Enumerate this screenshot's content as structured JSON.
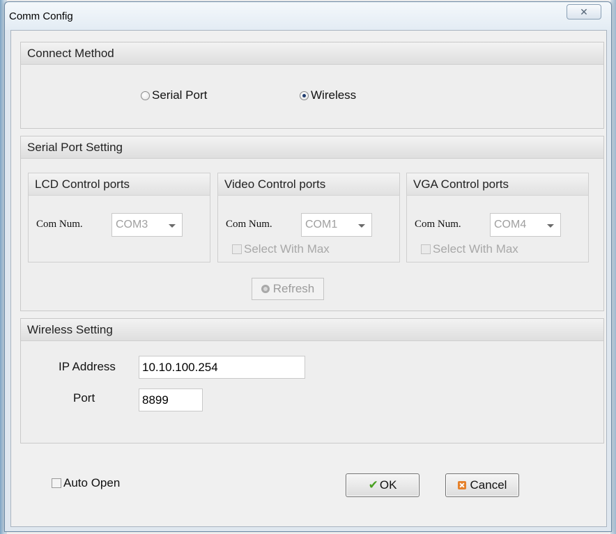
{
  "window": {
    "title": "Comm Config",
    "close_glyph": "✕"
  },
  "connect_method": {
    "title": "Connect Method",
    "options": [
      {
        "label": "Serial Port",
        "checked": false
      },
      {
        "label": "Wireless",
        "checked": true
      }
    ]
  },
  "serial_port_setting": {
    "title": "Serial Port Setting",
    "com_label": "Com Num.",
    "groups": [
      {
        "title": "LCD Control ports",
        "com_value": "COM3"
      },
      {
        "title": "Video Control ports",
        "com_value": "COM1",
        "select_with_max": "Select With Max"
      },
      {
        "title": "VGA Control ports",
        "com_value": "COM4",
        "select_with_max": "Select With Max"
      }
    ],
    "refresh_label": "Refresh"
  },
  "wireless_setting": {
    "title": "Wireless Setting",
    "ip_label": "IP Address",
    "ip_value": "10.10.100.254",
    "port_label": "Port",
    "port_value": "8899"
  },
  "footer": {
    "auto_open_label": "Auto Open",
    "ok_label": "OK",
    "cancel_label": "Cancel"
  },
  "colors": {
    "ok_check": "#48a020",
    "cancel_icon": "#e5812b",
    "radio_checked": "#1f3b6e"
  },
  "icons": {
    "close": "close-icon",
    "ok": "checkmark-icon",
    "cancel": "cancel-icon",
    "refresh": "refresh-icon"
  }
}
